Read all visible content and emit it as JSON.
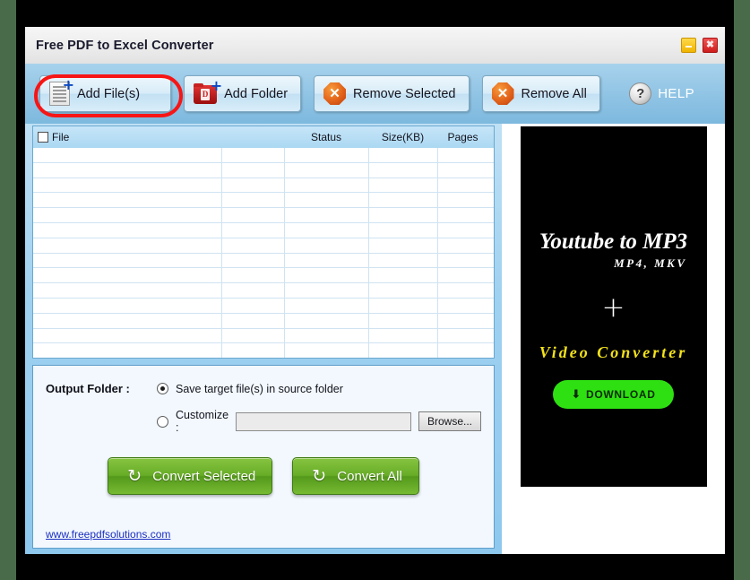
{
  "window": {
    "title": "Free PDF to Excel Converter",
    "controls": {
      "minimize_label": "",
      "close_label": "✖"
    }
  },
  "toolbar": {
    "add_files_label": "Add File(s)",
    "add_folder_label": "Add Folder",
    "remove_selected_label": "Remove Selected",
    "remove_all_label": "Remove All",
    "help_label": "HELP",
    "help_icon_glyph": "?",
    "remove_icon_glyph": "✕",
    "folder_page_letter": "D",
    "plus_badge": "+",
    "highlighted_button": "Add File(s)",
    "highlight_color": "#f71515"
  },
  "file_table": {
    "columns": [
      "File",
      "",
      "Status",
      "Size(KB)",
      "Pages"
    ],
    "rows": [],
    "select_all_checked": false,
    "empty_row_count": 14
  },
  "output": {
    "section_label": "Output Folder :",
    "option_source_label": "Save target file(s) in source folder",
    "option_source_selected": true,
    "option_customize_label": "Customize :",
    "option_customize_selected": false,
    "path_value": "",
    "path_placeholder": "",
    "browse_label": "Browse..."
  },
  "actions": {
    "convert_selected_label": "Convert Selected",
    "convert_all_label": "Convert All",
    "convert_icon_glyph": "↻"
  },
  "footer": {
    "site_link": "www.freepdfsolutions.com"
  },
  "ad": {
    "title": "Youtube to MP3",
    "formats": "MP4, MKV",
    "plus": "+",
    "subtitle": "Video Converter",
    "download_label": "DOWNLOAD",
    "download_arrow": "⬇",
    "background": "#000000",
    "accent": "#2ee012",
    "subtitle_color": "#f2e21c"
  }
}
